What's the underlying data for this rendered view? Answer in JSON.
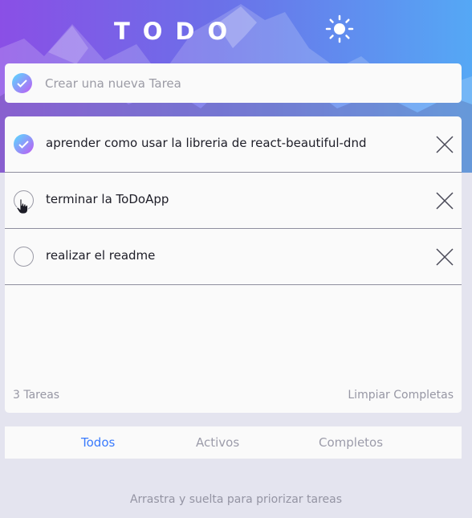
{
  "header": {
    "title": "TODO",
    "theme_icon": "sun-icon"
  },
  "new_task": {
    "placeholder": "Crear una nueva Tarea",
    "value": "",
    "checked": true
  },
  "tasks": [
    {
      "text": "aprender como usar la libreria de react-beautiful-dnd",
      "completed": true
    },
    {
      "text": "terminar la ToDoApp",
      "completed": false
    },
    {
      "text": "realizar el readme",
      "completed": false
    }
  ],
  "footer": {
    "count": "3 Tareas",
    "clear": "Limpiar Completas"
  },
  "filters": {
    "all": "Todos",
    "active": "Activos",
    "completed": "Completos",
    "selected": "all"
  },
  "hint": "Arrastra y suelta para priorizar tareas",
  "colors": {
    "accent": "#3a7bfd",
    "check_gradient_start": "#57ddff",
    "check_gradient_end": "#c058f3",
    "background": "#e4e4ef",
    "card": "#fafafa"
  }
}
